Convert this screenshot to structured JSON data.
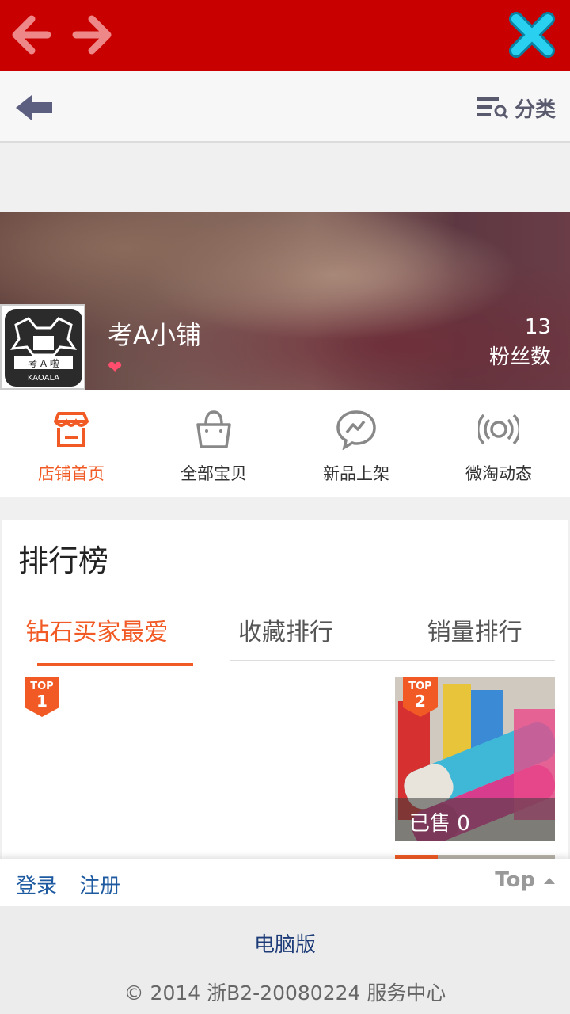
{
  "header": {
    "category_label": "分类"
  },
  "shop": {
    "name": "考A小铺",
    "fans_count": "13",
    "fans_label": "粉丝数"
  },
  "logo": {
    "top_text": "考 A 啦",
    "brand": "KAOALA"
  },
  "nav": [
    {
      "label": "店铺首页",
      "icon": "store-icon",
      "active": true
    },
    {
      "label": "全部宝贝",
      "icon": "bag-icon",
      "active": false
    },
    {
      "label": "新品上架",
      "icon": "chat-bolt-icon",
      "active": false
    },
    {
      "label": "微淘动态",
      "icon": "broadcast-icon",
      "active": false
    }
  ],
  "ranking": {
    "title": "排行榜",
    "tabs": [
      "钻石买家最爱",
      "收藏排行",
      "销量排行"
    ],
    "active_tab": 0,
    "items": [
      {
        "badge_top": "TOP",
        "badge_rank": "1"
      },
      {
        "badge_top": "TOP",
        "badge_rank": "2",
        "sold": "已售 0"
      }
    ]
  },
  "loginbar": {
    "login": "登录",
    "register": "注册",
    "top": "Top"
  },
  "footer": {
    "pc_version": "电脑版",
    "copyright": "© 2014 浙B2-20080224   服务中心"
  },
  "colors": {
    "topbar": "#c80000",
    "accent": "#f15a24",
    "link": "#1e5aa0"
  }
}
